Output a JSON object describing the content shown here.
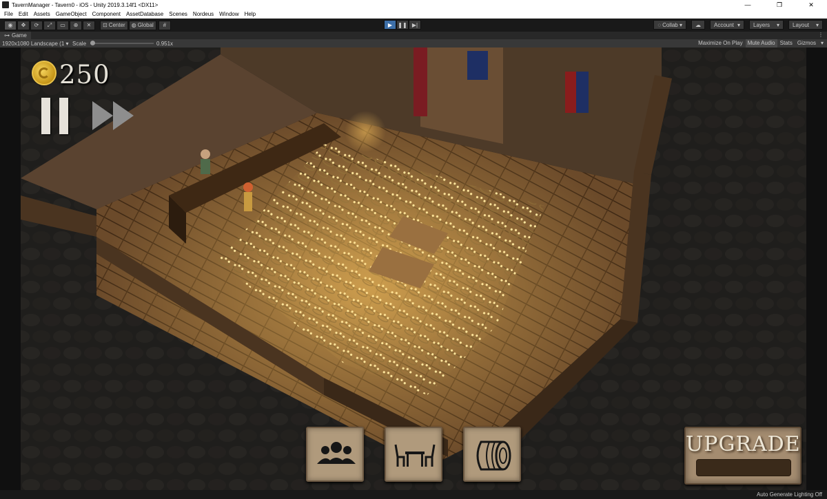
{
  "window": {
    "title": "TavernManager - Tavern0 - iOS - Unity 2019.3.14f1 <DX11>",
    "controls": [
      "—",
      "❐",
      "✕"
    ]
  },
  "menu": [
    "File",
    "Edit",
    "Assets",
    "GameObject",
    "Component",
    "AssetDatabase",
    "Scenes",
    "Nordeus",
    "Window",
    "Help"
  ],
  "toolbar": {
    "tools": [
      "view-tool",
      "move-tool",
      "rotate-tool",
      "scale-tool",
      "rect-tool",
      "transform-tool",
      "custom-tool"
    ],
    "pivot": "Center",
    "space": "Global",
    "collab": "Collab ▾",
    "account": "Account",
    "layers": "Layers",
    "layout": "Layout",
    "play_state": "playing"
  },
  "game_tab": {
    "label": "Game",
    "resolution": "1920x1080 Landscape (1",
    "scale_label": "Scale",
    "scale_value": "0.951x",
    "scale_fraction": 0.0,
    "maximize": "Maximize On Play",
    "mute": "Mute Audio",
    "stats": "Stats",
    "gizmos": "Gizmos"
  },
  "hud": {
    "coins": "250",
    "upgrade_label": "UPGRADE",
    "bottom_buttons": [
      "staff-icon",
      "table-chairs-icon",
      "barrel-icon"
    ]
  },
  "status": {
    "lighting": "Auto Generate Lighting Off"
  },
  "colors": {
    "accent_play": "#3d6fa8",
    "panel_bg": "#b09a7c",
    "coin_gold": "#e9c24a"
  }
}
